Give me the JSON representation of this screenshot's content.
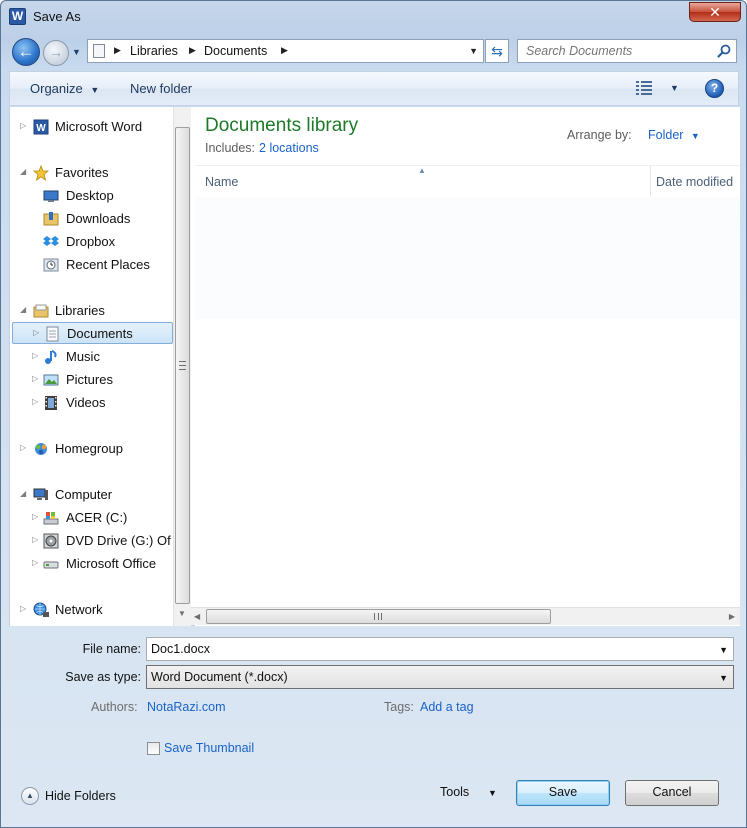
{
  "window": {
    "title": "Save As",
    "app_icon_letter": "W"
  },
  "nav": {
    "breadcrumb": [
      "Libraries",
      "Documents"
    ],
    "search_placeholder": "Search Documents"
  },
  "toolbar": {
    "organize_label": "Organize",
    "new_folder_label": "New folder",
    "help_label": "?"
  },
  "sidebar": {
    "items": [
      {
        "label": "Microsoft Word",
        "icon": "word-icon"
      },
      {
        "label": "Favorites",
        "icon": "star-icon"
      },
      {
        "label": "Desktop",
        "icon": "desktop-icon"
      },
      {
        "label": "Downloads",
        "icon": "downloads-folder-icon"
      },
      {
        "label": "Dropbox",
        "icon": "dropbox-icon"
      },
      {
        "label": "Recent Places",
        "icon": "recent-places-icon"
      },
      {
        "label": "Libraries",
        "icon": "libraries-icon"
      },
      {
        "label": "Documents",
        "icon": "documents-icon",
        "selected": true
      },
      {
        "label": "Music",
        "icon": "music-icon"
      },
      {
        "label": "Pictures",
        "icon": "pictures-icon"
      },
      {
        "label": "Videos",
        "icon": "videos-icon"
      },
      {
        "label": "Homegroup",
        "icon": "homegroup-icon"
      },
      {
        "label": "Computer",
        "icon": "computer-icon"
      },
      {
        "label": "ACER (C:)",
        "icon": "drive-icon"
      },
      {
        "label": "DVD Drive (G:) Of",
        "icon": "dvd-drive-icon"
      },
      {
        "label": "Microsoft Office",
        "icon": "removable-drive-icon"
      },
      {
        "label": "Network",
        "icon": "network-icon"
      }
    ]
  },
  "main": {
    "library_title": "Documents library",
    "includes_label": "Includes:",
    "includes_link": "2 locations",
    "arrange_label": "Arrange by:",
    "arrange_value": "Folder",
    "columns": [
      "Name",
      "Date modified"
    ]
  },
  "form": {
    "file_name_label": "File name:",
    "file_name_value": "Doc1.docx",
    "save_type_label": "Save as type:",
    "save_type_value": "Word Document (*.docx)",
    "authors_label": "Authors:",
    "authors_value": "NotaRazi.com",
    "tags_label": "Tags:",
    "tags_value": "Add a tag",
    "thumbnail_label": "Save Thumbnail"
  },
  "footer": {
    "hide_folders_label": "Hide Folders",
    "tools_label": "Tools",
    "save_label": "Save",
    "cancel_label": "Cancel"
  }
}
